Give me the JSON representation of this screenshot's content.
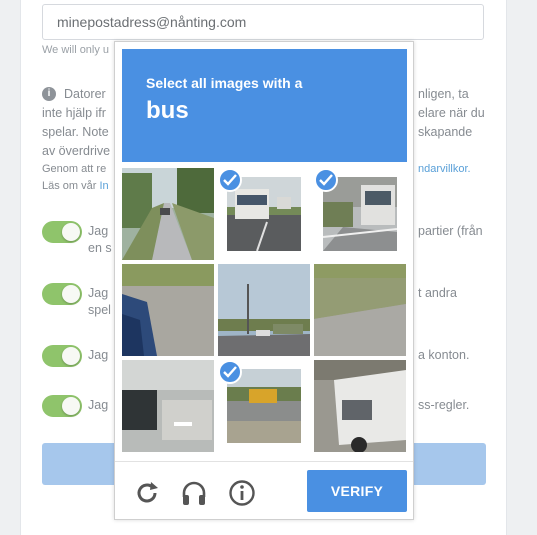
{
  "form": {
    "email_value": "minepostadress@nånting.com",
    "hint": "We will only u",
    "info_icon": "i",
    "para_left": [
      "Datorer",
      "inte hjälp ifr",
      "spelar. Note",
      "av överdrive"
    ],
    "para_right": [
      "nligen, ta",
      "elare när du",
      "skapande"
    ],
    "small_left": [
      "Genom att re",
      "Läs om vår"
    ],
    "small_link_left": "In",
    "small_link_right": "ndarvillkor.",
    "toggles": [
      {
        "left": "Jag",
        "left2": "en s",
        "right": "partier (från"
      },
      {
        "left": "Jag",
        "left2": "spel",
        "right": "t andra"
      },
      {
        "left": "Jag",
        "right": "a konton."
      },
      {
        "left": "Jag",
        "right": "ss-regler."
      }
    ]
  },
  "captcha": {
    "instruction": "Select all images with a",
    "target": "bus",
    "tiles": [
      {
        "scene": "road-trees",
        "selected": false
      },
      {
        "scene": "rv-bus",
        "selected": true
      },
      {
        "scene": "bus-stop",
        "selected": true
      },
      {
        "scene": "car-side",
        "selected": false
      },
      {
        "scene": "intersection",
        "selected": false
      },
      {
        "scene": "grass-road",
        "selected": false
      },
      {
        "scene": "building-corner",
        "selected": false
      },
      {
        "scene": "school-bus",
        "selected": true
      },
      {
        "scene": "van",
        "selected": false
      }
    ],
    "verify_label": "VERIFY",
    "icons": [
      "reload-icon",
      "headphones-icon",
      "info-icon"
    ],
    "accent": "#4a90e2"
  }
}
